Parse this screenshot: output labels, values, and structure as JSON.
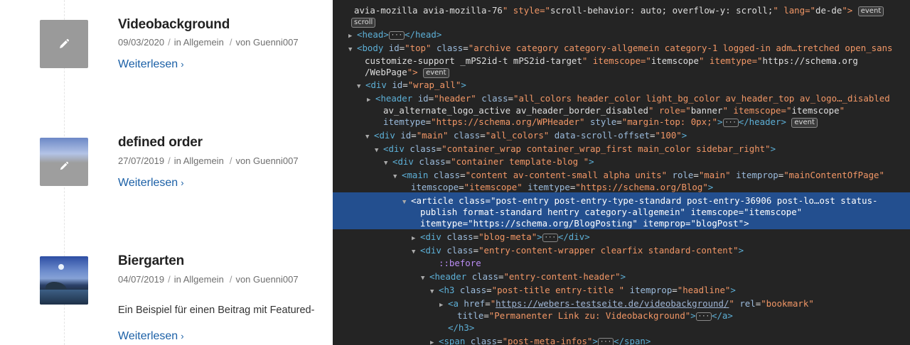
{
  "blog": {
    "posts": [
      {
        "title": "Videobackground",
        "date": "09/03/2020",
        "category": "in Allgemein",
        "author": "von Guenni007",
        "read_more": "Weiterlesen",
        "thumbnail": "pencil-placeholder"
      },
      {
        "title": "defined order",
        "date": "27/07/2019",
        "category": "in Allgemein",
        "author": "von Guenni007",
        "read_more": "Weiterlesen",
        "thumbnail": "pencil-placeholder-blue"
      },
      {
        "title": "Biergarten",
        "date": "04/07/2019",
        "category": "in Allgemein",
        "author": "von Guenni007",
        "excerpt": "Ein Beispiel für einen Beitrag mit Featured-",
        "read_more": "Weiterlesen",
        "thumbnail": "coast-photo"
      }
    ],
    "meta_separator": "/",
    "chevron": "›"
  },
  "devtools": {
    "lines": [
      {
        "t": "avia-mozilla avia-mozilla-76\" style=\"scroll-behavior: auto; overflow-y: scroll;\" lang=\"de-de\">"
      },
      {
        "t": "<head>…</head>"
      },
      {
        "t": "<body id=\"top\" class=\"archive category category-allgemein category-1 logged-in adm…tretched open_sans"
      },
      {
        "t": "customize-support _mPS2id-t mPS2id-target\" itemscope=\"itemscope\" itemtype=\"https://schema.org"
      },
      {
        "t": "/WebPage\">"
      },
      {
        "t": "<div id=\"wrap_all\">"
      },
      {
        "t": "<header id=\"header\" class=\"all_colors header_color light_bg_color av_header_top av_logo…_disabled"
      },
      {
        "t": "av_alternate_logo_active av_header_border_disabled\" role=\"banner\" itemscope=\"itemscope\""
      },
      {
        "t": "itemtype=\"https://schema.org/WPHeader\" style=\"margin-top: 0px;\">…</header>"
      },
      {
        "t": "<div id=\"main\" class=\"all_colors\" data-scroll-offset=\"100\">"
      },
      {
        "t": "<div class=\"container_wrap container_wrap_first main_color sidebar_right\">"
      },
      {
        "t": "<div class=\"container template-blog \">"
      },
      {
        "t": "<main class=\"content av-content-small alpha units\" role=\"main\" itemprop=\"mainContentOfPage\""
      },
      {
        "t": "itemscope=\"itemscope\" itemtype=\"https://schema.org/Blog\">"
      },
      {
        "t": "<article class=\"post-entry post-entry-type-standard post-entry-36906 post-lo…ost status-"
      },
      {
        "t": "publish format-standard hentry category-allgemein\" itemscope=\"itemscope\""
      },
      {
        "t": "itemtype=\"https://schema.org/BlogPosting\" itemprop=\"blogPost\">"
      },
      {
        "t": "<div class=\"blog-meta\">…</div>"
      },
      {
        "t": "<div class=\"entry-content-wrapper clearfix standard-content\">"
      },
      {
        "t": "::before"
      },
      {
        "t": "<header class=\"entry-content-header\">"
      },
      {
        "t": "<h3 class=\"post-title entry-title \" itemprop=\"headline\">"
      },
      {
        "t": "<a href=\"https://webers-testseite.de/videobackground/\" rel=\"bookmark\""
      },
      {
        "t": "title=\"Permanenter Link zu: Videobackground\">…</a>"
      },
      {
        "t": "</h3>"
      },
      {
        "t": "<span class=\"post-meta-infos\">…</span>"
      }
    ],
    "badges": {
      "event": "event",
      "scroll": "scroll"
    },
    "ellipsis": "···"
  }
}
